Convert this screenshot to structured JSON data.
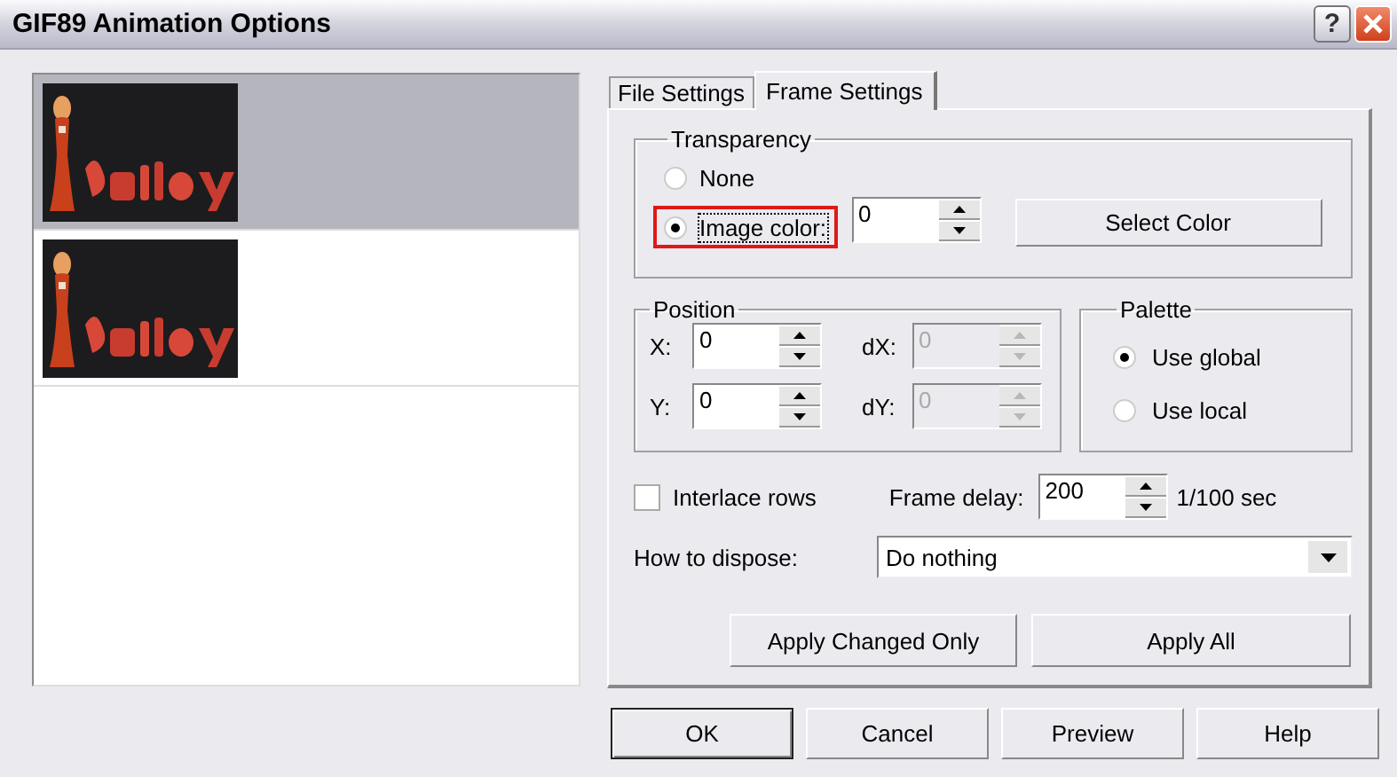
{
  "window": {
    "title": "GIF89 Animation Options",
    "help_button": "?"
  },
  "frames": [
    {
      "kind": "picture",
      "selected": true
    },
    {
      "kind": "picture",
      "selected": false
    }
  ],
  "tabs": [
    {
      "label": "File Settings",
      "selected": false
    },
    {
      "label": "Frame Settings",
      "selected": true
    }
  ],
  "transparency": {
    "title": "Transparency",
    "options": [
      {
        "label": "None",
        "selected": false,
        "highlighted": false
      },
      {
        "label": "Image color:",
        "selected": true,
        "highlighted": true
      }
    ],
    "color_index": "0",
    "select_button": "Select Color"
  },
  "position": {
    "title": "Position",
    "fields": [
      {
        "label": "X:",
        "value": "0",
        "disabled": false
      },
      {
        "label": "dX:",
        "value": "0",
        "disabled": true
      },
      {
        "label": "Y:",
        "value": "0",
        "disabled": false
      },
      {
        "label": "dY:",
        "value": "0",
        "disabled": true
      }
    ]
  },
  "palette": {
    "title": "Palette",
    "options": [
      {
        "label": "Use global",
        "selected": true
      },
      {
        "label": "Use local",
        "selected": false
      }
    ]
  },
  "interlace": {
    "label": "Interlace rows",
    "checked": false
  },
  "frame_delay": {
    "label": "Frame delay:",
    "value": "200",
    "unit": "1/100 sec"
  },
  "dispose": {
    "label": "How to dispose:",
    "value": "Do nothing"
  },
  "apply_buttons": [
    "Apply Changed Only",
    "Apply All"
  ],
  "buttons": [
    {
      "label": "OK",
      "default": true
    },
    {
      "label": "Cancel",
      "default": false
    },
    {
      "label": "Preview",
      "default": false
    },
    {
      "label": "Help",
      "default": false
    }
  ]
}
